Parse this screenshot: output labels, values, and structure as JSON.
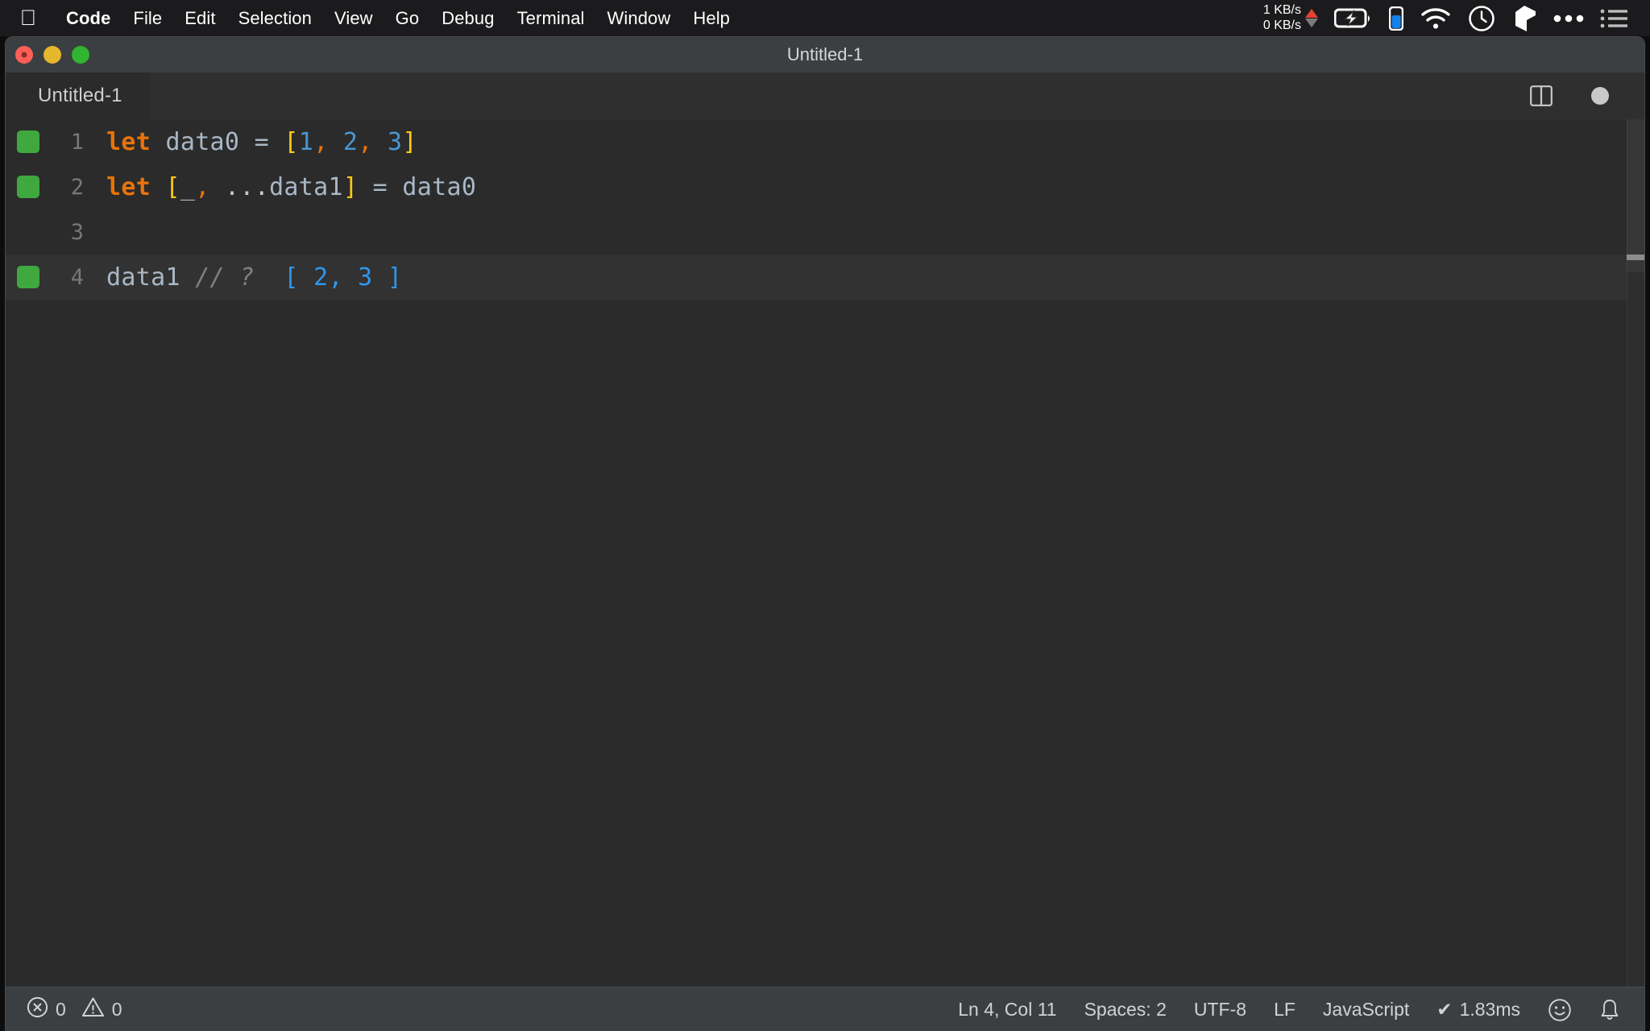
{
  "menubar": {
    "apple_icon": "apple-logo",
    "items": [
      {
        "label": "Code",
        "bold": true
      },
      {
        "label": "File",
        "bold": false
      },
      {
        "label": "Edit",
        "bold": false
      },
      {
        "label": "Selection",
        "bold": false
      },
      {
        "label": "View",
        "bold": false
      },
      {
        "label": "Go",
        "bold": false
      },
      {
        "label": "Debug",
        "bold": false
      },
      {
        "label": "Terminal",
        "bold": false
      },
      {
        "label": "Window",
        "bold": false
      },
      {
        "label": "Help",
        "bold": false
      }
    ],
    "status_items": {
      "net_up": "1 KB/s",
      "net_down": "0 KB/s",
      "battery_icon": "battery-charging-icon",
      "indicator_icon": "battery-level-icon",
      "wifi_icon": "wifi-icon",
      "clock_icon": "clock-icon",
      "cube_icon": "cube-icon",
      "ellipsis_icon": "ellipsis-icon",
      "list_icon": "list-icon"
    },
    "colors": {
      "upload_arrow": "#e8422f",
      "download_arrow": "#7b7b7b"
    }
  },
  "window": {
    "title": "Untitled-1",
    "traffic_lights": [
      "close",
      "minimize",
      "zoom"
    ]
  },
  "tabbar": {
    "tabs": [
      {
        "label": "Untitled-1",
        "active": true,
        "dirty": true
      }
    ],
    "actions": [
      {
        "name": "split-editor-icon",
        "label": "Split Editor"
      },
      {
        "name": "unsaved-dot-icon",
        "label": "Unsaved changes"
      }
    ]
  },
  "editor": {
    "language": "JavaScript",
    "lines": [
      {
        "number": "1",
        "has_gutter_mark": true,
        "active": false,
        "tokens": [
          {
            "text": "let",
            "type": "kw"
          },
          {
            "text": " ",
            "type": "plain"
          },
          {
            "text": "data0",
            "type": "var"
          },
          {
            "text": " ",
            "type": "plain"
          },
          {
            "text": "=",
            "type": "op"
          },
          {
            "text": " ",
            "type": "plain"
          },
          {
            "text": "[",
            "type": "bracket"
          },
          {
            "text": "1",
            "type": "num"
          },
          {
            "text": ",",
            "type": "comma"
          },
          {
            "text": " ",
            "type": "plain"
          },
          {
            "text": "2",
            "type": "num"
          },
          {
            "text": ",",
            "type": "comma"
          },
          {
            "text": " ",
            "type": "plain"
          },
          {
            "text": "3",
            "type": "num"
          },
          {
            "text": "]",
            "type": "bracket"
          }
        ]
      },
      {
        "number": "2",
        "has_gutter_mark": true,
        "active": false,
        "tokens": [
          {
            "text": "let",
            "type": "kw"
          },
          {
            "text": " ",
            "type": "plain"
          },
          {
            "text": "[",
            "type": "bracket"
          },
          {
            "text": "_",
            "type": "var"
          },
          {
            "text": ",",
            "type": "comma"
          },
          {
            "text": " ",
            "type": "plain"
          },
          {
            "text": "...",
            "type": "spread"
          },
          {
            "text": "data1",
            "type": "var"
          },
          {
            "text": "]",
            "type": "bracket"
          },
          {
            "text": " ",
            "type": "plain"
          },
          {
            "text": "=",
            "type": "op"
          },
          {
            "text": " ",
            "type": "plain"
          },
          {
            "text": "data0",
            "type": "var"
          }
        ]
      },
      {
        "number": "3",
        "has_gutter_mark": false,
        "active": false,
        "tokens": []
      },
      {
        "number": "4",
        "has_gutter_mark": true,
        "active": true,
        "tokens": [
          {
            "text": "data1",
            "type": "var"
          },
          {
            "text": " ",
            "type": "plain"
          },
          {
            "text": "// ?",
            "type": "comment"
          },
          {
            "text": "  ",
            "type": "plain"
          },
          {
            "text": "[ 2, 3 ]",
            "type": "result"
          }
        ]
      }
    ],
    "colors": {
      "background": "#2b2b2b",
      "active_line": "#323232",
      "keyword": "#e8730a",
      "variable": "#a9b7c6",
      "bracket": "#ffc817",
      "number": "#4a96d2",
      "comment": "#808080",
      "result": "#2f96ea",
      "gutter_mark": "#3fa83f",
      "line_number": "#787878"
    }
  },
  "statusbar": {
    "errors": {
      "icon": "error-circle-icon",
      "count": "0"
    },
    "warnings": {
      "icon": "warning-triangle-icon",
      "count": "0"
    },
    "cursor_position": "Ln 4, Col 11",
    "indentation": "Spaces: 2",
    "encoding": "UTF-8",
    "eol": "LF",
    "language_mode": "JavaScript",
    "run_time": "1.83ms",
    "run_check": "✔",
    "feedback_icon": "smiley-icon",
    "notifications_icon": "bell-icon"
  }
}
